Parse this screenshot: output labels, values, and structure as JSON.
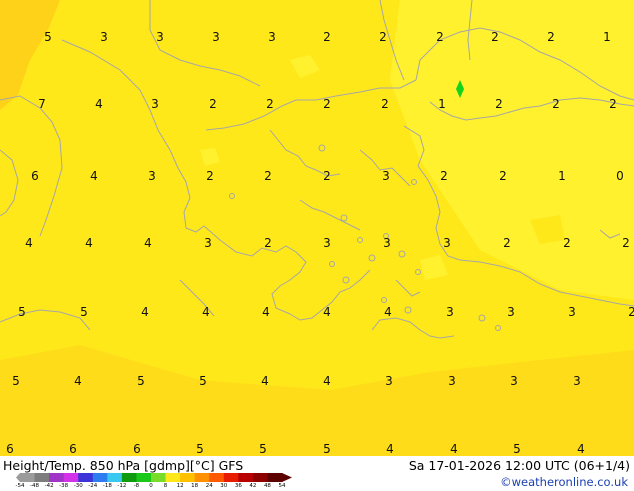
{
  "map": {
    "colors": {
      "field": "#ffe81a",
      "warm": "#ffd21a",
      "cool": "#fff12e",
      "coast": "#a6a6a6",
      "marker": "#13d31b"
    },
    "marker_icon": "green-diamond"
  },
  "temperature_labels": [
    [
      "5",
      "3",
      "3",
      "3",
      "3",
      "2",
      "2",
      "2",
      "2",
      "2",
      "1"
    ],
    [
      "7",
      "4",
      "3",
      "2",
      "2",
      "2",
      "2",
      "1",
      "2",
      "2",
      "2"
    ],
    [
      "6",
      "4",
      "3",
      "2",
      "2",
      "2",
      "3",
      "2",
      "2",
      "1",
      "0"
    ],
    [
      "4",
      "4",
      "4",
      "3",
      "2",
      "3",
      "3",
      "3",
      "2",
      "2",
      "2"
    ],
    [
      "5",
      "5",
      "4",
      "4",
      "4",
      "4",
      "4",
      "3",
      "3",
      "3",
      "2"
    ],
    [
      "5",
      "4",
      "5",
      "5",
      "4",
      "4",
      "3",
      "3",
      "3",
      "3"
    ],
    [
      "6",
      "6",
      "6",
      "5",
      "5",
      "5",
      "4",
      "4",
      "5",
      "4"
    ]
  ],
  "footer": {
    "title": "Height/Temp. 850 hPa [gdmp][°C] GFS",
    "run_info": "Sa 17-01-2026 12:00 UTC (06+1/4)",
    "credit": "©weatheronline.co.uk",
    "scale_labels": [
      "-54",
      "-48",
      "-42",
      "-38",
      "-30",
      "-24",
      "-18",
      "-12",
      "-8",
      "0",
      "8",
      "12",
      "18",
      "24",
      "30",
      "36",
      "42",
      "48",
      "54"
    ],
    "scale_colors": [
      "#9b9b9b",
      "#7d7d7d",
      "#a035c8",
      "#d233e8",
      "#3c34d8",
      "#2f7cf0",
      "#38c8f0",
      "#0f9a0f",
      "#19c819",
      "#78dc28",
      "#ffe81a",
      "#ffc000",
      "#ff9000",
      "#ff5a00",
      "#e81c00",
      "#b80000",
      "#8c0000",
      "#5c0000"
    ]
  }
}
